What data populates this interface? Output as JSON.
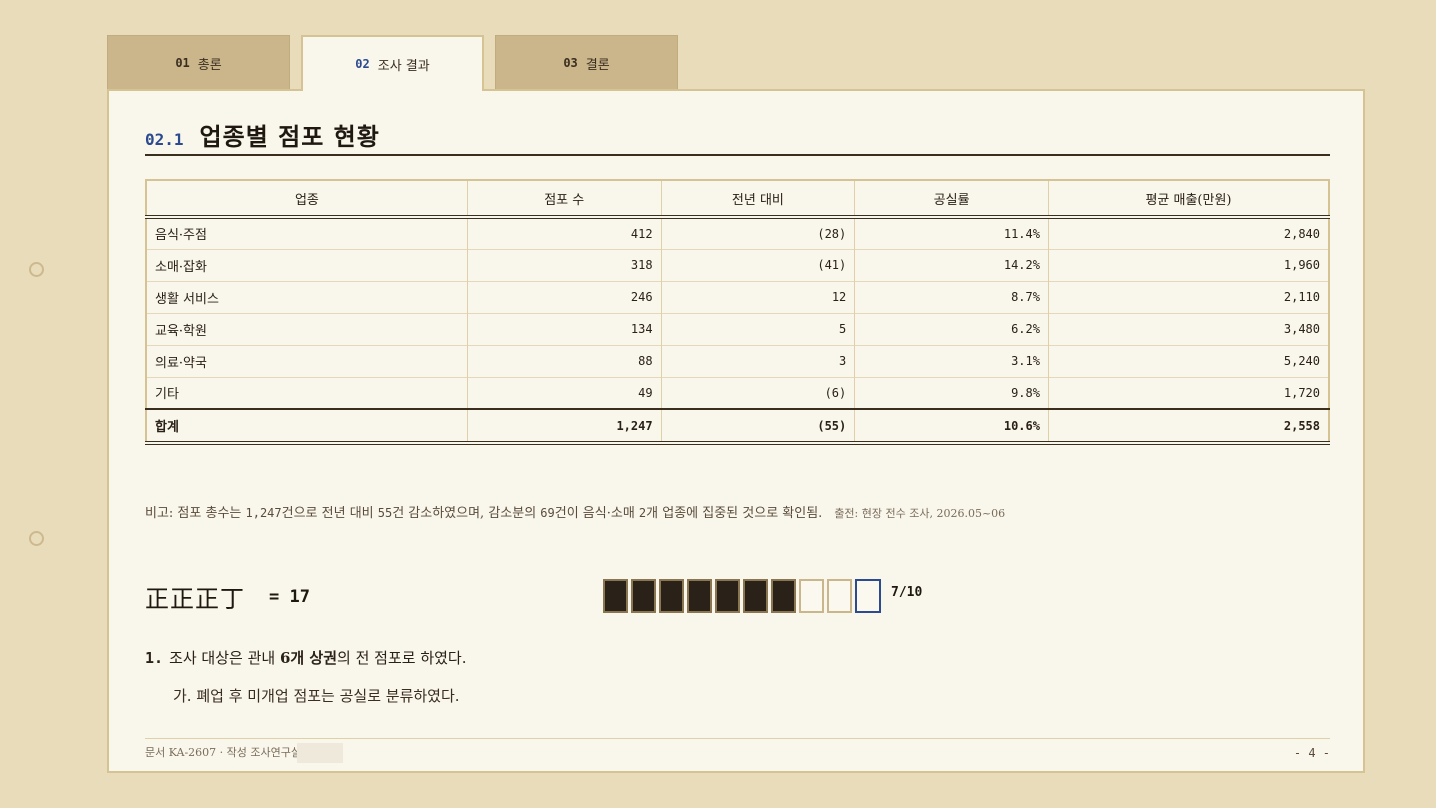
{
  "tabs": [
    {
      "num": "01",
      "label": "총론"
    },
    {
      "num": "02",
      "label": "조사 결과"
    },
    {
      "num": "03",
      "label": "결론"
    }
  ],
  "section": {
    "num": "02.1",
    "title": "업종별 점포 현황"
  },
  "table": {
    "headers": [
      "업종",
      "점포 수",
      "전년 대비",
      "공실률",
      "평균 매출(만원)"
    ],
    "rows": [
      [
        "음식·주점",
        "412",
        "(28)",
        "11.4%",
        "2,840"
      ],
      [
        "소매·잡화",
        "318",
        "(41)",
        "14.2%",
        "1,960"
      ],
      [
        "생활 서비스",
        "246",
        "12",
        "8.7%",
        "2,110"
      ],
      [
        "교육·학원",
        "134",
        "5",
        "6.2%",
        "3,480"
      ],
      [
        "의료·약국",
        "88",
        "3",
        "3.1%",
        "5,240"
      ],
      [
        "기타",
        "49",
        "(6)",
        "9.8%",
        "1,720"
      ]
    ],
    "total": [
      "합계",
      "1,247",
      "(55)",
      "10.6%",
      "2,558"
    ]
  },
  "note": {
    "p1": "비고: 점포 총수는 ",
    "n1": "1,247",
    "p2": "건으로 전년 대비 ",
    "n2": "55",
    "p3": "건 감소하였으며, 감소분의 ",
    "n3": "69",
    "p4": "건이 음식·소매 ",
    "n4": "2",
    "p5": "개 업종에 집중된 것으로 확인됨.",
    "source": "출전: 현장 전수 조사, 2026.05~06"
  },
  "tally": {
    "marks": "正正正丁",
    "eq": "= 17"
  },
  "progress": {
    "filled": 7,
    "total": 10,
    "label": "7/10"
  },
  "list": {
    "item1_num": "1.",
    "item1_pre": "조사 대상은 관내 ",
    "item1_bold": "6개 상권",
    "item1_post": "의 전 점포로 하였다.",
    "item2": "가. 폐업 후 미개업 점포는 공실로 분류하였다."
  },
  "footer": {
    "doc": "문서 KA-2607 · 작성 조사연구실",
    "page": "- 4 -"
  }
}
